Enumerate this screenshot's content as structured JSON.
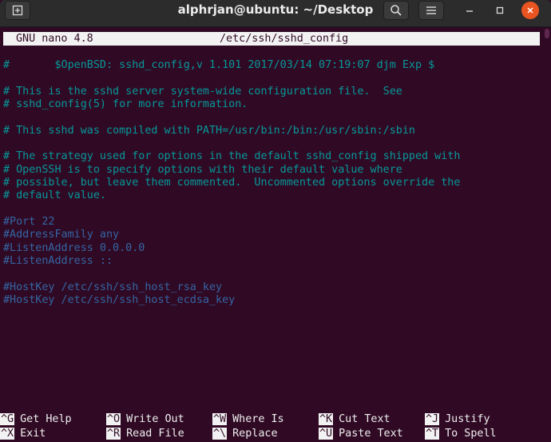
{
  "window": {
    "title": "alphrjan@ubuntu: ~/Desktop"
  },
  "nano": {
    "version": "GNU nano 4.8",
    "filename": "/etc/ssh/sshd_config"
  },
  "lines": [
    {
      "text": "#       $OpenBSD: sshd_config,v 1.101 2017/03/14 07:19:07 djm Exp $",
      "kind": "comment"
    },
    {
      "text": "",
      "kind": "blank"
    },
    {
      "text": "# This is the sshd server system-wide configuration file.  See",
      "kind": "comment"
    },
    {
      "text": "# sshd_config(5) for more information.",
      "kind": "comment"
    },
    {
      "text": "",
      "kind": "blank"
    },
    {
      "text": "# This sshd was compiled with PATH=/usr/bin:/bin:/usr/sbin:/sbin",
      "kind": "comment"
    },
    {
      "text": "",
      "kind": "blank"
    },
    {
      "text": "# The strategy used for options in the default sshd_config shipped with",
      "kind": "comment"
    },
    {
      "text": "# OpenSSH is to specify options with their default value where",
      "kind": "comment"
    },
    {
      "text": "# possible, but leave them commented.  Uncommented options override the",
      "kind": "comment"
    },
    {
      "text": "# default value.",
      "kind": "comment"
    },
    {
      "text": "",
      "kind": "blank"
    },
    {
      "text": "#Port 22",
      "kind": "directive"
    },
    {
      "text": "#AddressFamily any",
      "kind": "directive"
    },
    {
      "text": "#ListenAddress 0.0.0.0",
      "kind": "directive"
    },
    {
      "text": "#ListenAddress ::",
      "kind": "directive"
    },
    {
      "text": "",
      "kind": "blank"
    },
    {
      "text": "#HostKey /etc/ssh/ssh_host_rsa_key",
      "kind": "directive"
    },
    {
      "text": "#HostKey /etc/ssh/ssh_host_ecdsa_key",
      "kind": "directive"
    }
  ],
  "shortcuts": [
    [
      {
        "key": "^G",
        "label": "Get Help"
      },
      {
        "key": "^O",
        "label": "Write Out"
      },
      {
        "key": "^W",
        "label": "Where Is"
      },
      {
        "key": "^K",
        "label": "Cut Text"
      },
      {
        "key": "^J",
        "label": "Justify"
      }
    ],
    [
      {
        "key": "^X",
        "label": "Exit"
      },
      {
        "key": "^R",
        "label": "Read File"
      },
      {
        "key": "^\\",
        "label": "Replace"
      },
      {
        "key": "^U",
        "label": "Paste Text"
      },
      {
        "key": "^T",
        "label": "To Spell"
      }
    ]
  ],
  "colors": {
    "terminal_bg": "#300a24",
    "comment": "#06989a",
    "directive": "#3465a4",
    "statusbar_bg": "#f2f2f2",
    "titlebar_bg": "#2c2c2c",
    "close_button": "#e95420"
  }
}
